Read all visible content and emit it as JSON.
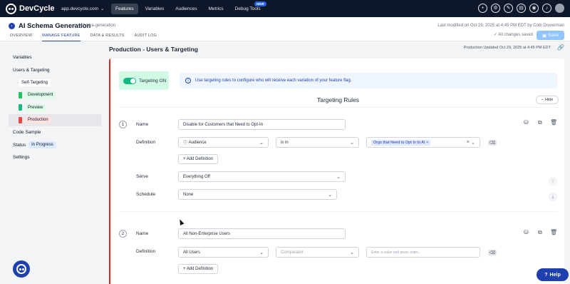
{
  "nav": {
    "brand": "DevCycle",
    "domain": "app.devcycle.com",
    "links": [
      "Features",
      "Variables",
      "Audiences",
      "Metrics",
      "Debug Tools"
    ],
    "new_badge": "NEW"
  },
  "header": {
    "title": "AI Schema Generation",
    "key": "ai-schema-generation",
    "modified": "Last modified on Oct 29, 2025 at 4:45 PM EDT by Cobi Druxerman",
    "saved": "All changes saved",
    "save": "Save",
    "tabs": [
      "OVERVIEW",
      "MANAGE FEATURE",
      "DATA & RESULTS",
      "AUDIT LOG"
    ]
  },
  "sidebar": {
    "variables": "Variables",
    "users_targeting": "Users & Targeting",
    "self_targeting": "Self-Targeting",
    "development": "Development",
    "preview": "Preview",
    "production": "Production",
    "code_sample": "Code Sample",
    "status_label": "Status",
    "status_value": "In Progress",
    "settings": "Settings",
    "dev_color": "#22c55e",
    "prev_color": "#10b981",
    "prod_color": "#ef4444"
  },
  "env": {
    "title": "Production - Users & Targeting",
    "updated": "Production Updated Oct 29, 2025 at 4:45 PM EDT"
  },
  "targeting": {
    "toggle": "Targeting ON",
    "info": "Use targeting rules to configure who will receive each variation of your feature flag.",
    "rules_title": "Targeting Rules",
    "hide": "Hide"
  },
  "rule1": {
    "num": "1",
    "name_label": "Name",
    "name": "Disable for Customers that Need to Opt-In",
    "def_label": "Definition",
    "property": "Audience",
    "operator": "is in",
    "value_chip": "Orgs that Need to Opt In to AI",
    "add_def": "+ Add Definition",
    "serve_label": "Serve",
    "serve": "Everything Off",
    "schedule_label": "Schedule",
    "schedule": "None"
  },
  "rule2": {
    "num": "2",
    "name_label": "Name",
    "name": "All Non-Enterprise Users",
    "def_label": "Definition",
    "property": "All Users",
    "operator": "Comparator",
    "value_placeholder": "Enter a value and press enter...",
    "add_def": "+ Add Definition"
  },
  "help": "Help"
}
